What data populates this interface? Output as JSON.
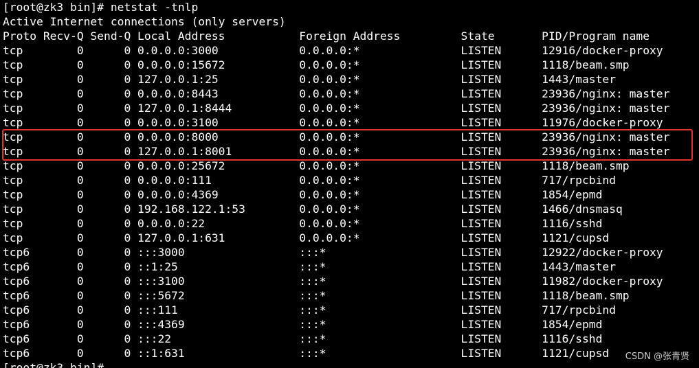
{
  "terminal": {
    "prompt_command": "[root@zk3 bin]# netstat -tnlp",
    "info_line": "Active Internet connections (only servers)",
    "header": "Proto Recv-Q Send-Q Local Address           Foreign Address         State       PID/Program name",
    "rows": [
      "tcp        0      0 0.0.0.0:3000            0.0.0.0:*               LISTEN      12916/docker-proxy",
      "tcp        0      0 0.0.0.0:15672           0.0.0.0:*               LISTEN      1118/beam.smp",
      "tcp        0      0 127.0.0.1:25            0.0.0.0:*               LISTEN      1443/master",
      "tcp        0      0 0.0.0.0:8443            0.0.0.0:*               LISTEN      23936/nginx: master",
      "tcp        0      0 127.0.0.1:8444          0.0.0.0:*               LISTEN      23936/nginx: master",
      "tcp        0      0 0.0.0.0:3100            0.0.0.0:*               LISTEN      11976/docker-proxy",
      "tcp        0      0 0.0.0.0:8000            0.0.0.0:*               LISTEN      23936/nginx: master",
      "tcp        0      0 127.0.0.1:8001          0.0.0.0:*               LISTEN      23936/nginx: master",
      "tcp        0      0 0.0.0.0:25672           0.0.0.0:*               LISTEN      1118/beam.smp",
      "tcp        0      0 0.0.0.0:111             0.0.0.0:*               LISTEN      717/rpcbind",
      "tcp        0      0 0.0.0.0:4369            0.0.0.0:*               LISTEN      1854/epmd",
      "tcp        0      0 192.168.122.1:53        0.0.0.0:*               LISTEN      1466/dnsmasq",
      "tcp        0      0 0.0.0.0:22              0.0.0.0:*               LISTEN      1116/sshd",
      "tcp        0      0 127.0.0.1:631           0.0.0.0:*               LISTEN      1121/cupsd",
      "tcp6       0      0 :::3000                 :::*                    LISTEN      12922/docker-proxy",
      "tcp6       0      0 ::1:25                  :::*                    LISTEN      1443/master",
      "tcp6       0      0 :::3100                 :::*                    LISTEN      11982/docker-proxy",
      "tcp6       0      0 :::5672                 :::*                    LISTEN      1118/beam.smp",
      "tcp6       0      0 :::111                  :::*                    LISTEN      717/rpcbind",
      "tcp6       0      0 :::4369                 :::*                    LISTEN      1854/epmd",
      "tcp6       0      0 :::22                   :::*                    LISTEN      1116/sshd",
      "tcp6       0      0 ::1:631                 :::*                    LISTEN      1121/cupsd"
    ],
    "final_prompt": "[root@zk3 bin]#"
  },
  "watermark": "CSDN @张青贤",
  "colors": {
    "background": "#000000",
    "text": "#ffffff",
    "highlight": "#e5322d"
  }
}
